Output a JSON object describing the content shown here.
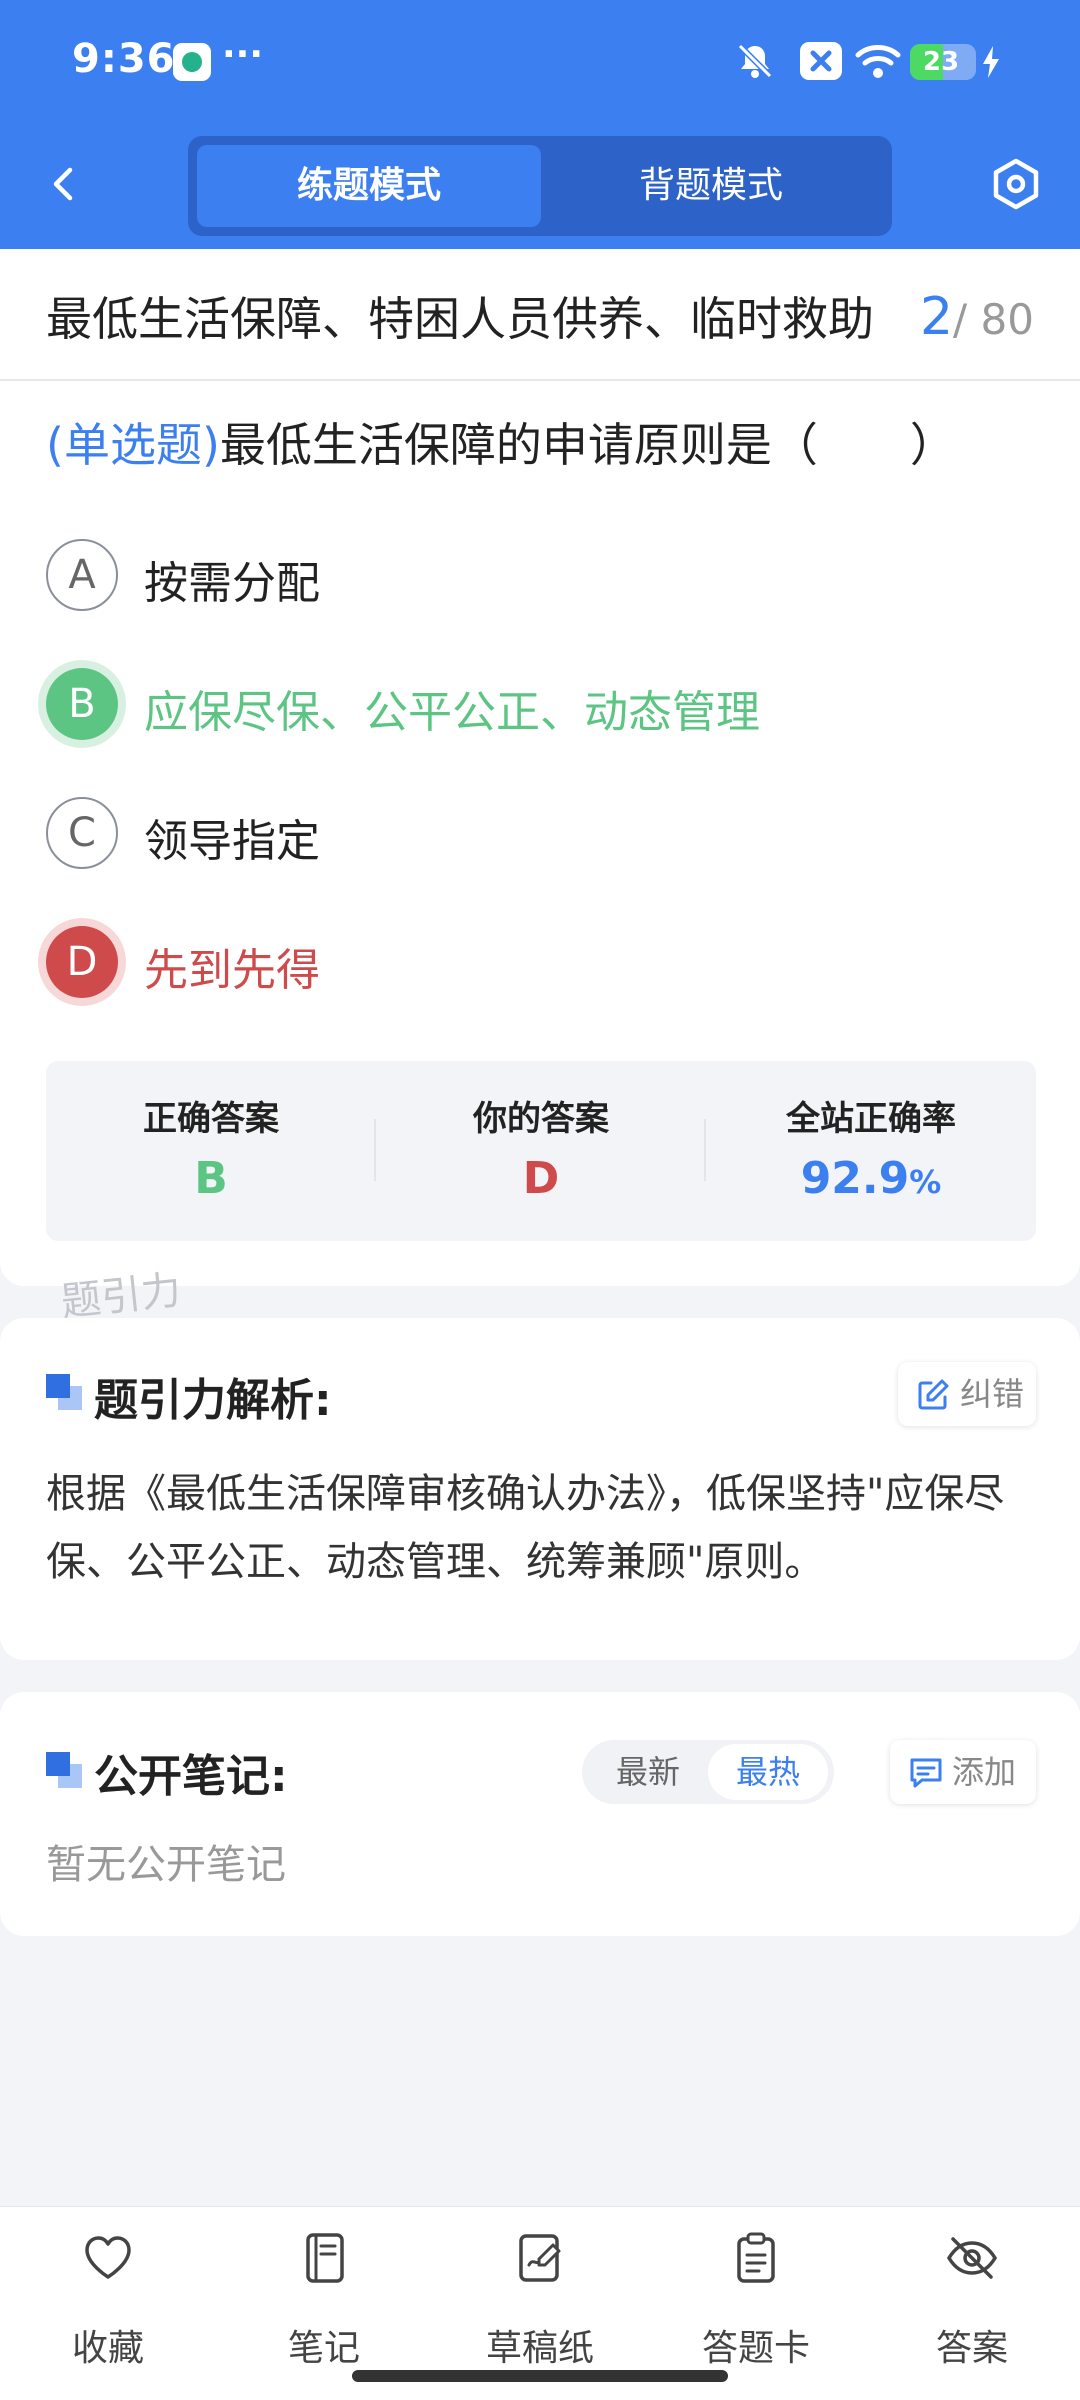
{
  "status": {
    "time": "9:36",
    "dots": "···",
    "battery": "23",
    "battery_level": 0.23
  },
  "header": {
    "tabs": [
      "练题模式",
      "背题模式"
    ],
    "active_tab": "练题模式"
  },
  "question": {
    "chapter_title": "最低生活保障、特困人员供养、临时救助",
    "current": "2",
    "total": "/ 80",
    "type": "(单选题)",
    "text": "最低生活保障的申请原则是（　　）",
    "options": [
      {
        "letter": "A",
        "text": "按需分配",
        "state": "normal"
      },
      {
        "letter": "B",
        "text": "应保尽保、公平公正、动态管理",
        "state": "correct"
      },
      {
        "letter": "C",
        "text": "领导指定",
        "state": "normal"
      },
      {
        "letter": "D",
        "text": "先到先得",
        "state": "wrong"
      }
    ]
  },
  "stats": {
    "correct_label": "正确答案",
    "correct_value": "B",
    "yours_label": "你的答案",
    "yours_value": "D",
    "rate_label": "全站正确率",
    "rate_value": "92.9",
    "rate_unit": "%"
  },
  "watermark": "题引力",
  "analysis": {
    "title": "题引力解析:",
    "correct_button": "纠错",
    "text": "根据《最低生活保障审核确认办法》，低保坚持\"应保尽保、公平公正、动态管理、统筹兼顾\"原则。"
  },
  "notes": {
    "title": "公开笔记:",
    "sort_options": [
      "最新",
      "最热"
    ],
    "active_sort": "最热",
    "add_button": "添加",
    "empty_text": "暂无公开笔记"
  },
  "toolbar": {
    "items": [
      "收藏",
      "笔记",
      "草稿纸",
      "答题卡",
      "答案"
    ]
  },
  "colors": {
    "brand_blue": "#3b7ff0",
    "correct_green": "#5cc584",
    "wrong_red": "#cf4b4b"
  }
}
